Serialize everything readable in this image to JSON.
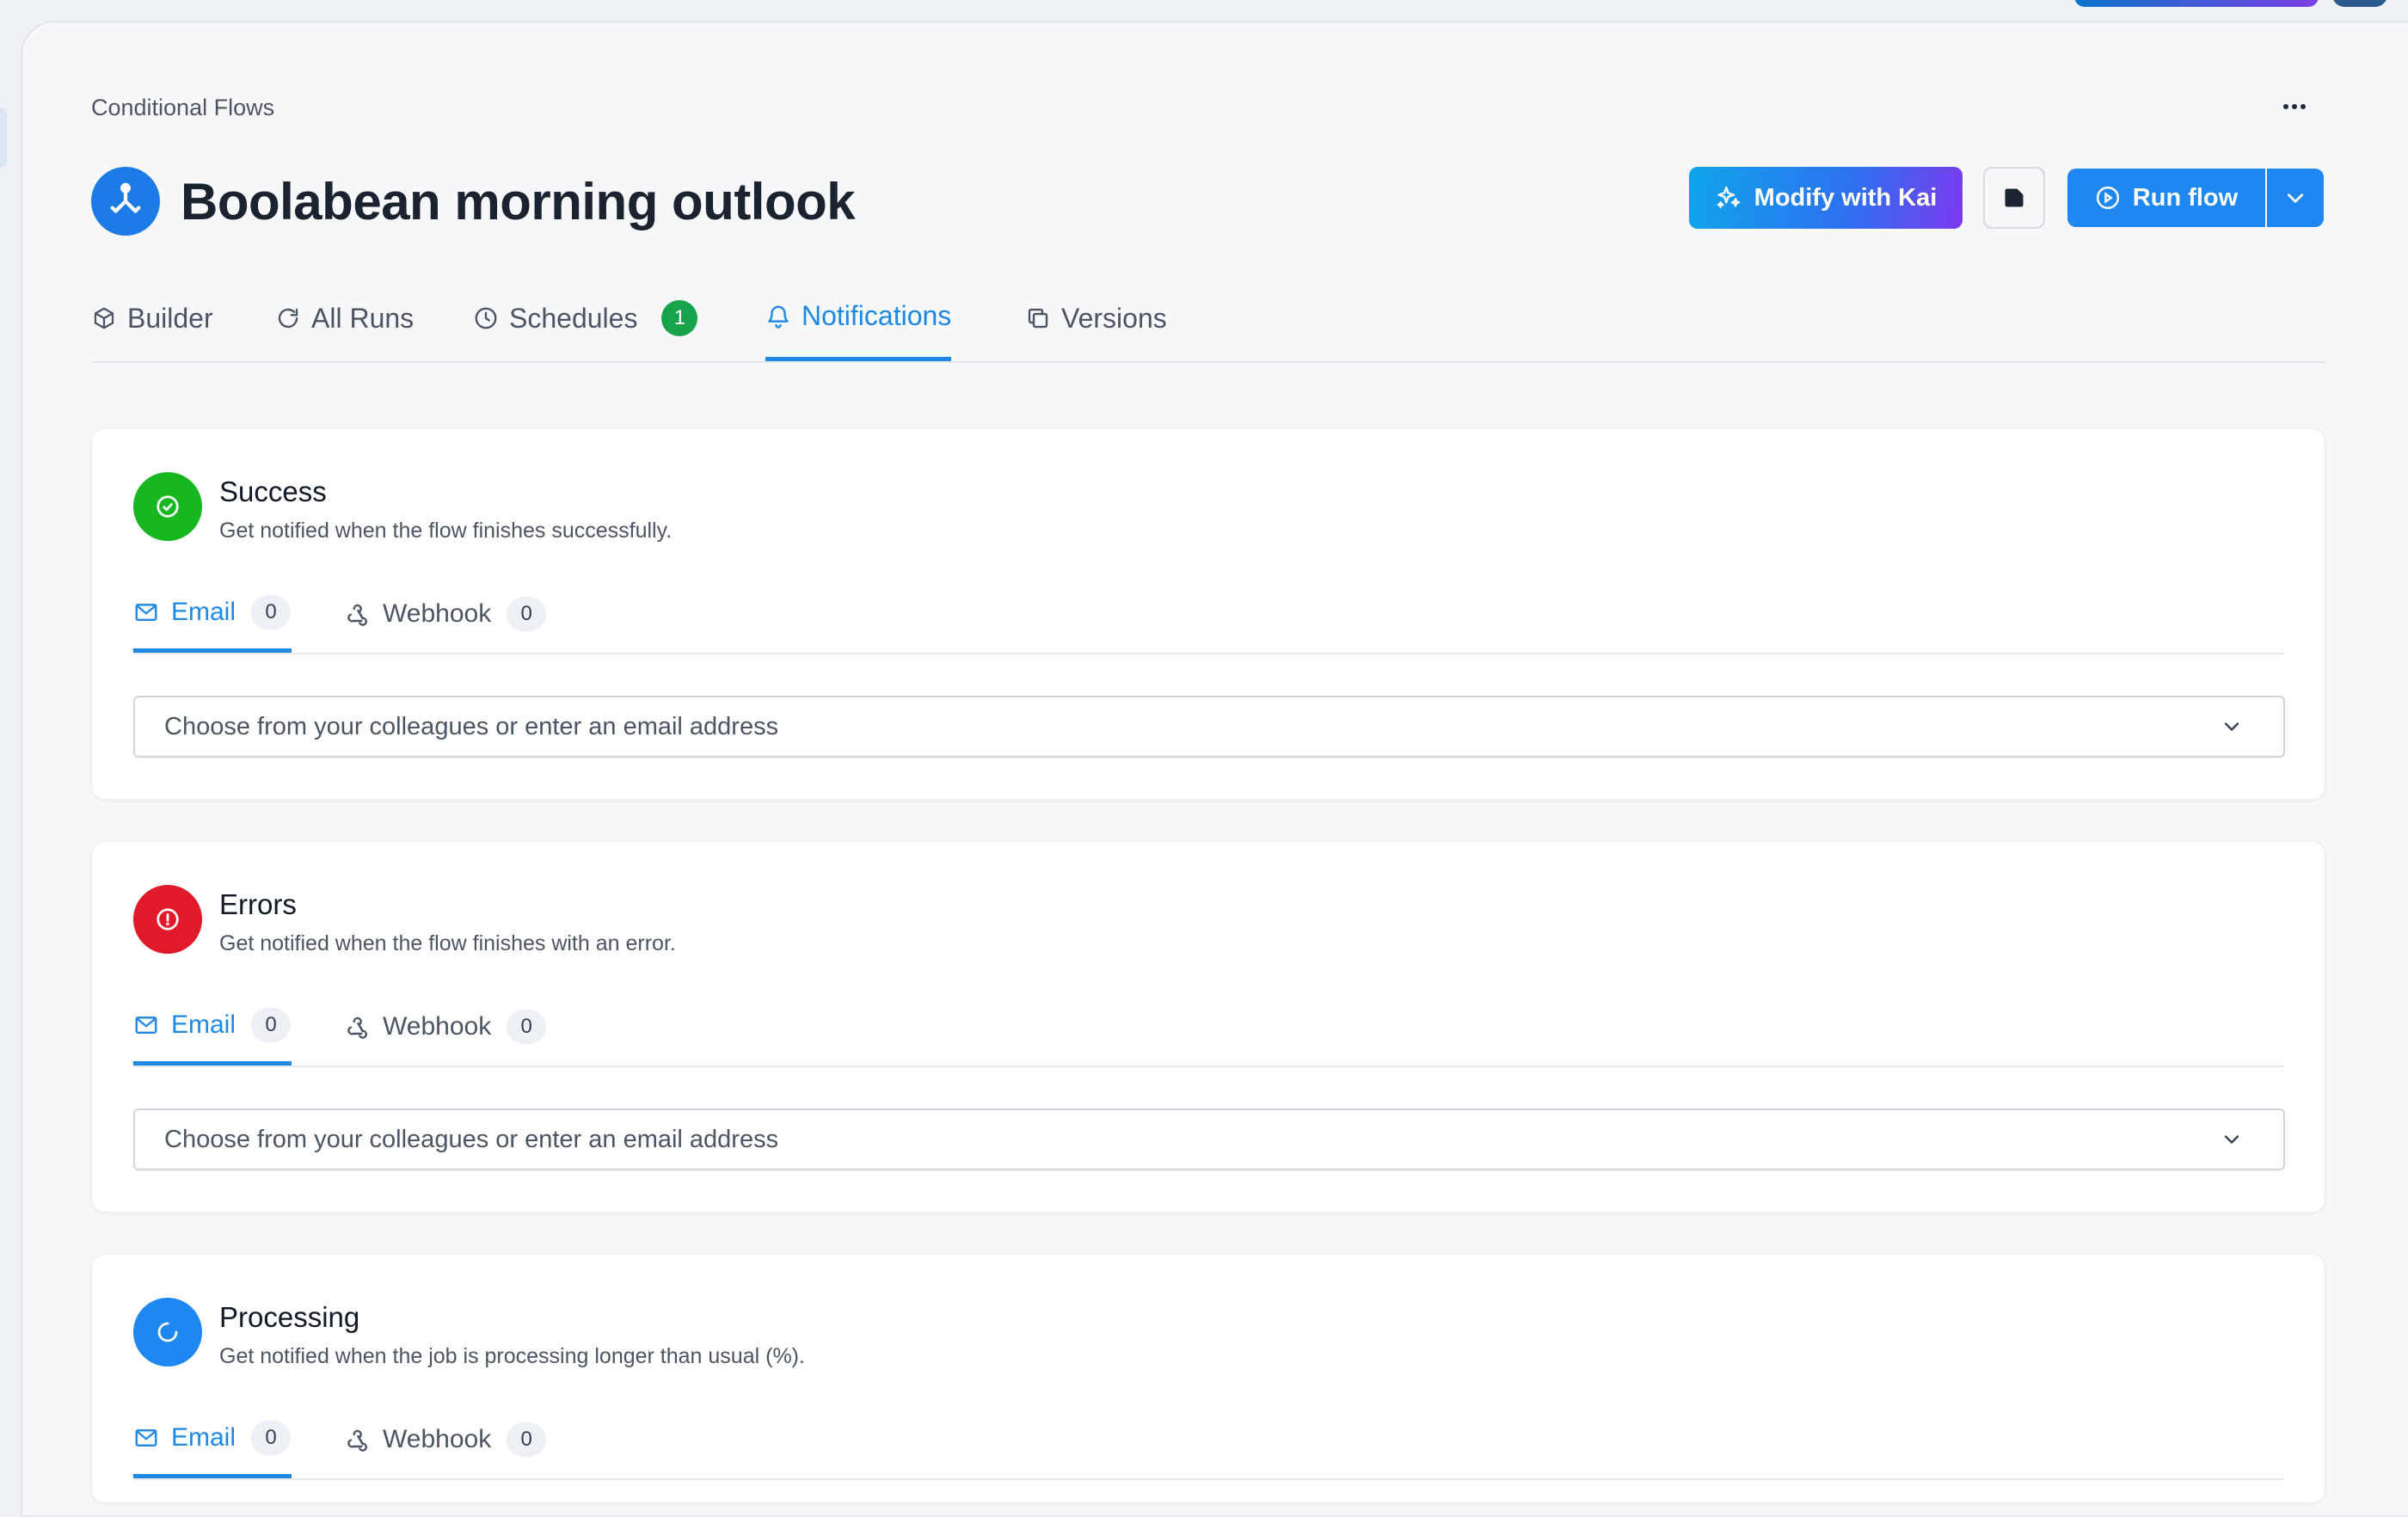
{
  "breadcrumb": "Conditional Flows",
  "flow": {
    "title": "Boolabean morning outlook"
  },
  "actions": {
    "modify_label": "Modify with Kai",
    "run_label": "Run flow"
  },
  "tabs": [
    {
      "label": "Builder",
      "icon": "cube-icon"
    },
    {
      "label": "All Runs",
      "icon": "refresh-icon"
    },
    {
      "label": "Schedules",
      "icon": "clock-icon",
      "badge": "1"
    },
    {
      "label": "Notifications",
      "icon": "bell-icon",
      "active": true
    },
    {
      "label": "Versions",
      "icon": "copy-icon"
    }
  ],
  "cards": [
    {
      "title": "Success",
      "description": "Get notified when the flow finishes successfully.",
      "color": "#16b71f",
      "email_label": "Email",
      "email_count": "0",
      "webhook_label": "Webhook",
      "webhook_count": "0",
      "placeholder": "Choose from your colleagues or enter an email address"
    },
    {
      "title": "Errors",
      "description": "Get notified when the flow finishes with an error.",
      "color": "#e01a2b",
      "email_label": "Email",
      "email_count": "0",
      "webhook_label": "Webhook",
      "webhook_count": "0",
      "placeholder": "Choose from your colleagues or enter an email address"
    },
    {
      "title": "Processing",
      "description": "Get notified when the job is processing longer than usual (%).",
      "color": "#1e88f0",
      "email_label": "Email",
      "email_count": "0",
      "webhook_label": "Webhook",
      "webhook_count": "0"
    }
  ],
  "colors": {
    "accent": "#1e88e5",
    "primary_button": "#1e88f0"
  }
}
